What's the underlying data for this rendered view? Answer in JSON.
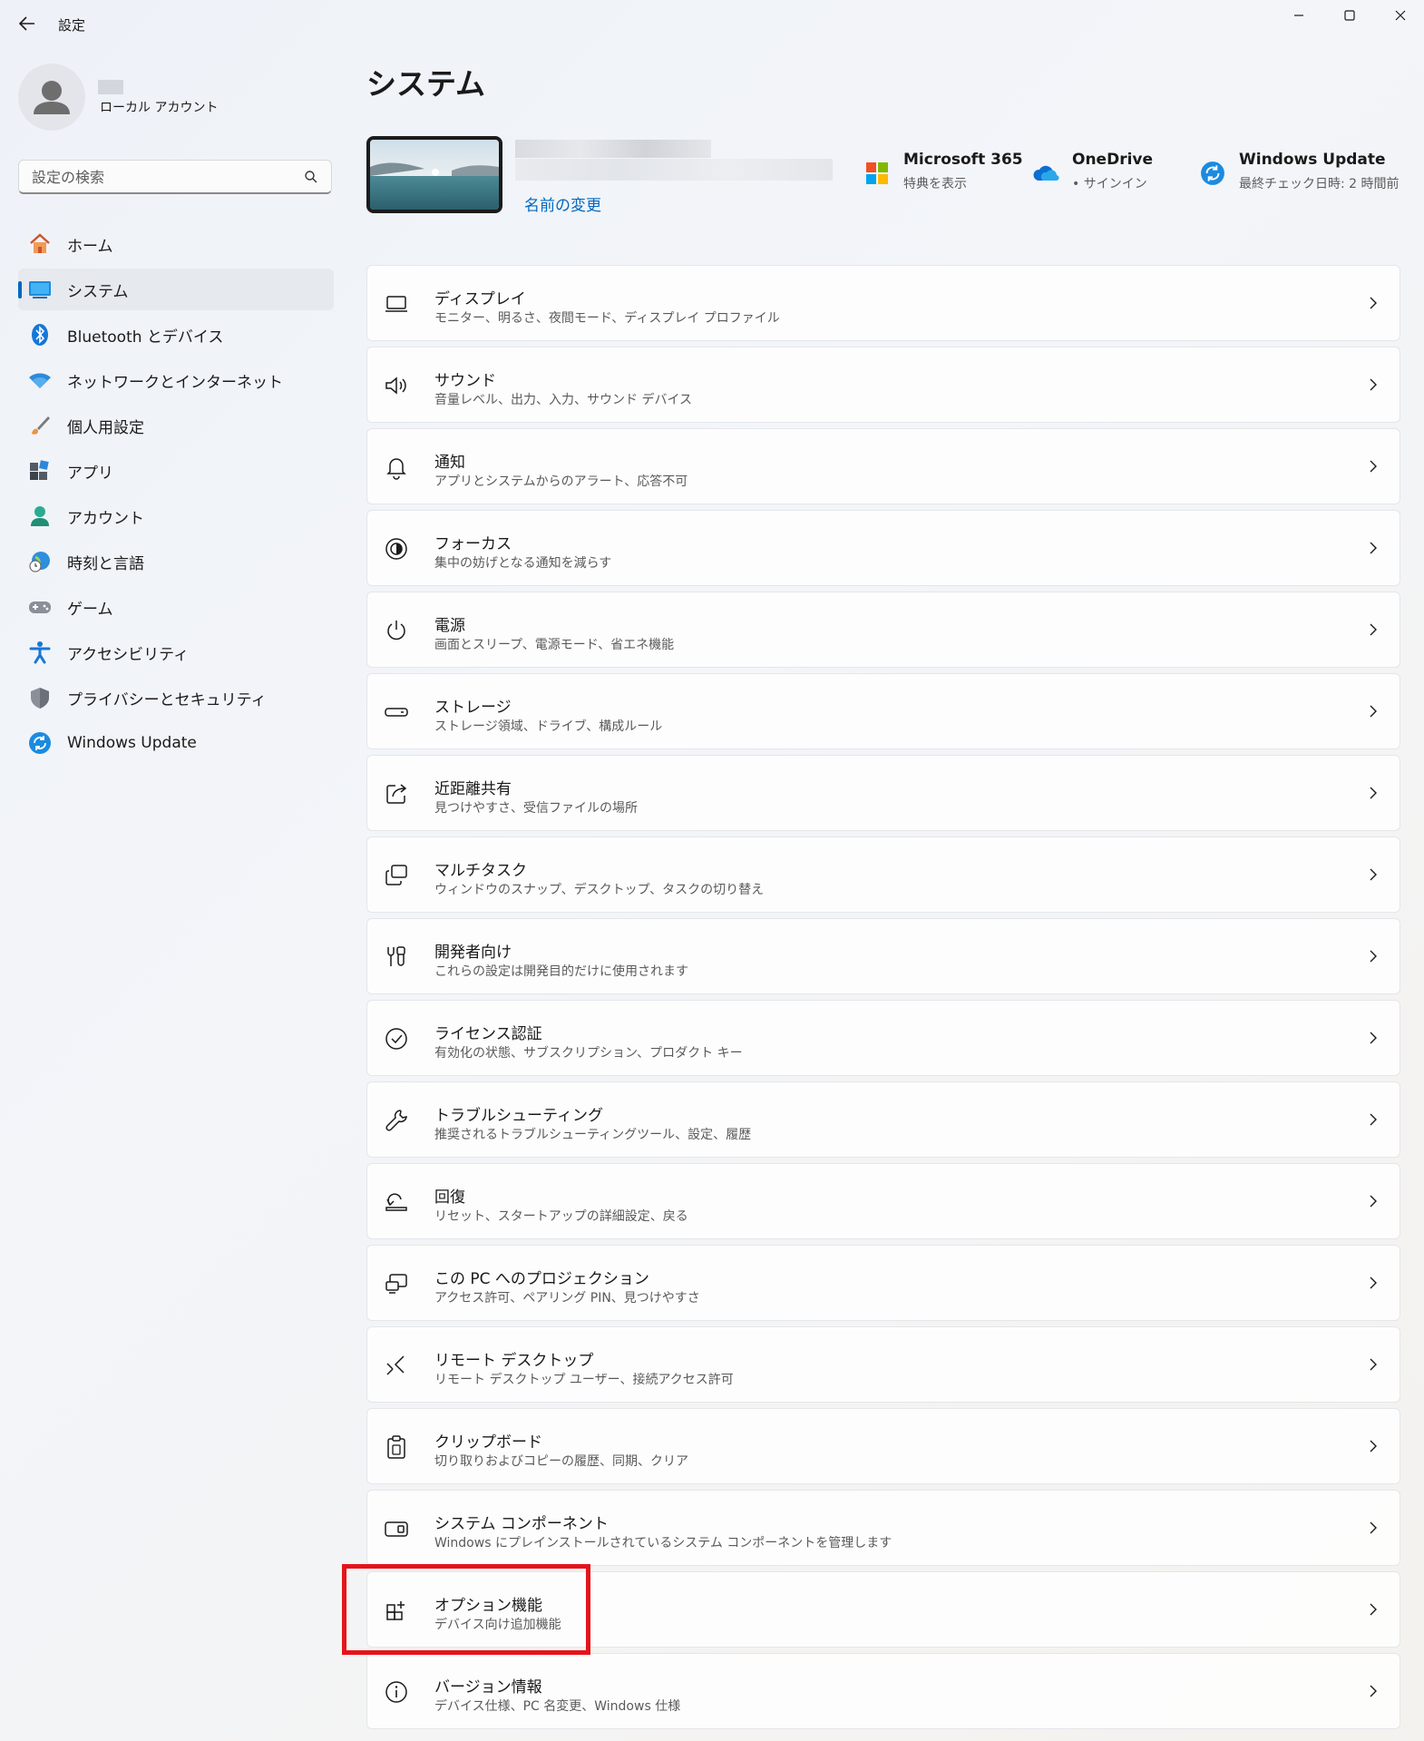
{
  "window": {
    "title": "設定",
    "minimize_icon": "minimize-icon",
    "maximize_icon": "maximize-icon",
    "close_icon": "close-icon"
  },
  "profile": {
    "account_type": "ローカル アカウント"
  },
  "search": {
    "placeholder": "設定の検索"
  },
  "sidebar": {
    "items": [
      {
        "label": "ホーム",
        "icon": "home-icon"
      },
      {
        "label": "システム",
        "icon": "system-icon",
        "active": true
      },
      {
        "label": "Bluetooth とデバイス",
        "icon": "bluetooth-icon"
      },
      {
        "label": "ネットワークとインターネット",
        "icon": "wifi-icon"
      },
      {
        "label": "個人用設定",
        "icon": "brush-icon"
      },
      {
        "label": "アプリ",
        "icon": "apps-icon"
      },
      {
        "label": "アカウント",
        "icon": "account-icon"
      },
      {
        "label": "時刻と言語",
        "icon": "time-language-icon"
      },
      {
        "label": "ゲーム",
        "icon": "gamepad-icon"
      },
      {
        "label": "アクセシビリティ",
        "icon": "accessibility-icon"
      },
      {
        "label": "プライバシーとセキュリティ",
        "icon": "shield-icon"
      },
      {
        "label": "Windows Update",
        "icon": "windows-update-icon"
      }
    ]
  },
  "main": {
    "title": "システム",
    "rename_link": "名前の変更",
    "quick_links": [
      {
        "title": "Microsoft 365",
        "subtitle": "特典を表示",
        "icon": "microsoft-logo-icon"
      },
      {
        "title": "OneDrive",
        "subtitle": "• サインイン",
        "icon": "onedrive-cloud-icon"
      },
      {
        "title": "Windows Update",
        "subtitle": "最終チェック日時: 2 時間前",
        "icon": "windows-update-icon"
      }
    ],
    "cards": [
      {
        "title": "ディスプレイ",
        "subtitle": "モニター、明るさ、夜間モード、ディスプレイ プロファイル",
        "icon": "display-icon"
      },
      {
        "title": "サウンド",
        "subtitle": "音量レベル、出力、入力、サウンド デバイス",
        "icon": "speaker-icon"
      },
      {
        "title": "通知",
        "subtitle": "アプリとシステムからのアラート、応答不可",
        "icon": "bell-icon"
      },
      {
        "title": "フォーカス",
        "subtitle": "集中の妨げとなる通知を減らす",
        "icon": "focus-icon"
      },
      {
        "title": "電源",
        "subtitle": "画面とスリープ、電源モード、省エネ機能",
        "icon": "power-icon"
      },
      {
        "title": "ストレージ",
        "subtitle": "ストレージ領域、ドライブ、構成ルール",
        "icon": "storage-icon"
      },
      {
        "title": "近距離共有",
        "subtitle": "見つけやすさ、受信ファイルの場所",
        "icon": "share-icon"
      },
      {
        "title": "マルチタスク",
        "subtitle": "ウィンドウのスナップ、デスクトップ、タスクの切り替え",
        "icon": "multitask-icon"
      },
      {
        "title": "開発者向け",
        "subtitle": "これらの設定は開発目的だけに使用されます",
        "icon": "developer-tools-icon"
      },
      {
        "title": "ライセンス認証",
        "subtitle": "有効化の状態、サブスクリプション、プロダクト キー",
        "icon": "check-circle-icon"
      },
      {
        "title": "トラブルシューティング",
        "subtitle": "推奨されるトラブルシューティングツール、設定、履歴",
        "icon": "wrench-icon"
      },
      {
        "title": "回復",
        "subtitle": "リセット、スタートアップの詳細設定、戻る",
        "icon": "recovery-icon"
      },
      {
        "title": "この PC へのプロジェクション",
        "subtitle": "アクセス許可、ペアリング PIN、見つけやすさ",
        "icon": "projection-icon"
      },
      {
        "title": "リモート デスクトップ",
        "subtitle": "リモート デスクトップ ユーザー、接続アクセス許可",
        "icon": "remote-desktop-icon"
      },
      {
        "title": "クリップボード",
        "subtitle": "切り取りおよびコピーの履歴、同期、クリア",
        "icon": "clipboard-icon"
      },
      {
        "title": "システム コンポーネント",
        "subtitle": "Windows にプレインストールされているシステム コンポーネントを管理します",
        "icon": "system-components-icon"
      },
      {
        "title": "オプション機能",
        "subtitle": "デバイス向け追加機能",
        "icon": "optional-features-icon",
        "highlighted": true
      },
      {
        "title": "バージョン情報",
        "subtitle": "デバイス仕様、PC 名変更、Windows 仕様",
        "icon": "info-icon"
      }
    ]
  },
  "colors": {
    "accent": "#0067c0",
    "highlight_border": "#e5141b"
  }
}
